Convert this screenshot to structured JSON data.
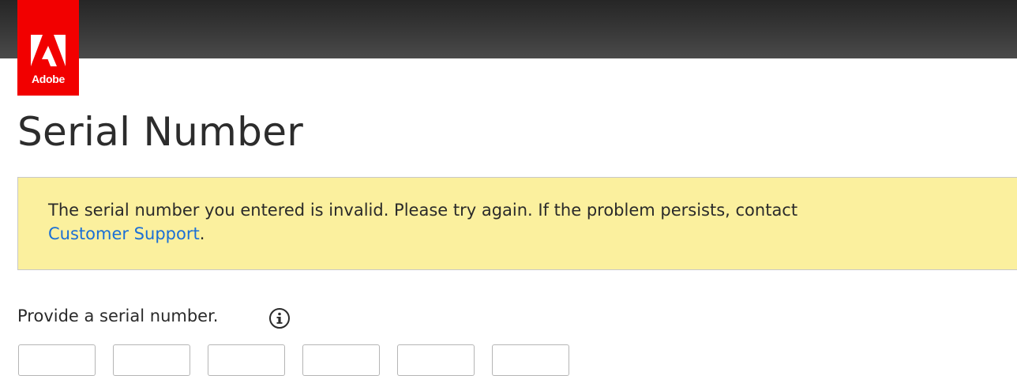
{
  "header": {
    "logo_text": "Adobe",
    "brand_color": "#f20000",
    "bar_color": "#353535"
  },
  "page_title": "Serial Number",
  "alert": {
    "message": "The serial number you entered is invalid. Please try again. If the problem persists, contact",
    "link_label": "Customer Support",
    "trailing": ".",
    "background": "#fbf09e",
    "link_color": "#1a6fd6"
  },
  "serial_prompt": "Provide a serial number.",
  "info_icon": "info-circle-icon",
  "serial_fields": [
    "",
    "",
    "",
    "",
    "",
    ""
  ]
}
